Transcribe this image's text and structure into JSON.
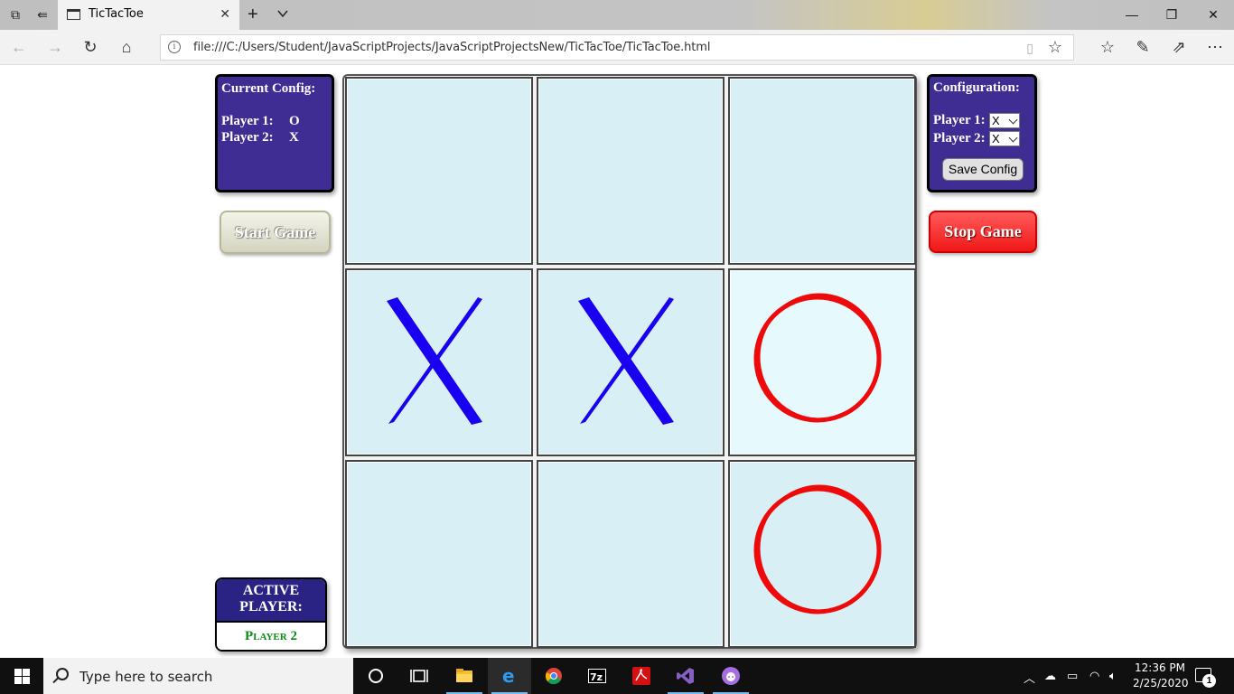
{
  "browser": {
    "tab_title": "TicTacToe",
    "address": "file:///C:/Users/Student/JavaScriptProjects/JavaScriptProjectsNew/TicTacToe/TicTacToe.html"
  },
  "current_config": {
    "title": "Current Config:",
    "player1_label": "Player 1:",
    "player1_value": "O",
    "player2_label": "Player 2:",
    "player2_value": "X"
  },
  "configuration": {
    "title": "Configuration:",
    "player1_label": "Player 1:",
    "player1_select": "X",
    "player2_label": "Player 2:",
    "player2_select": "X",
    "save_label": "Save Config"
  },
  "buttons": {
    "start": "Start Game",
    "stop": "Stop Game"
  },
  "active_player": {
    "heading_line1": "ACTIVE",
    "heading_line2": "PLAYER:",
    "value": "Player 2"
  },
  "board": {
    "cells": [
      "",
      "",
      "",
      "X",
      "X",
      "O",
      "",
      "",
      "O"
    ],
    "highlighted_cell": 5,
    "x_color": "#1a00f0",
    "o_color": "#ee0a0a"
  },
  "taskbar": {
    "search_placeholder": "Type here to search",
    "time": "12:36 PM",
    "date": "2/25/2020",
    "notification_count": "1"
  }
}
